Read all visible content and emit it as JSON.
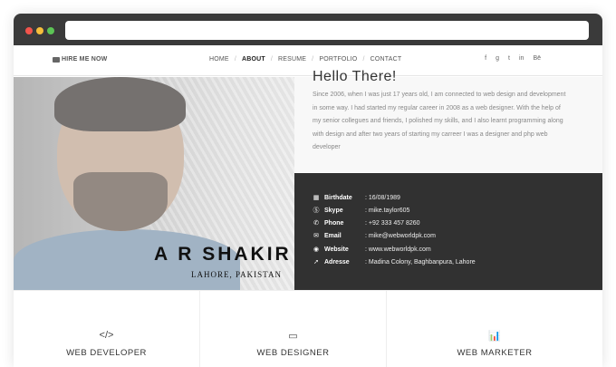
{
  "nav": {
    "hire_label": "HIRE ME NOW",
    "menu": [
      "HOME",
      "ABOUT",
      "RESUME",
      "PORTFOLIO",
      "CONTACT"
    ],
    "active": "ABOUT",
    "social": [
      "f",
      "g",
      "t",
      "in",
      "Bē"
    ]
  },
  "profile": {
    "name": "A R SHAKIR",
    "location": "LAHORE, PAKISTAN"
  },
  "about": {
    "heading": "Hello There!",
    "paragraph": "Since 2006, when I was just 17 years old, I am connected to web design and development in some way. I had started my regular career in 2008 as a web designer. With the help of my senior collegues and friends, I polished my skills, and I also learnt programming along with design and after two years of starting my carreer I was a designer and php web developer"
  },
  "info": [
    {
      "icon": "calendar-icon",
      "label": "Birthdate",
      "value": ": 16/08/1989"
    },
    {
      "icon": "skype-icon",
      "label": "Skype",
      "value": ": mike.taylor605"
    },
    {
      "icon": "phone-icon",
      "label": "Phone",
      "value": ": +92 333 457 8260"
    },
    {
      "icon": "envelope-icon",
      "label": "Email",
      "value": ": mike@webworldpk.com"
    },
    {
      "icon": "globe-icon",
      "label": "Website",
      "value": ": www.webworldpk.com"
    },
    {
      "icon": "location-arrow-icon",
      "label": "Adresse",
      "value": ": Madina Colony, Baghbanpura, Lahore"
    }
  ],
  "services": [
    {
      "icon": "code-icon",
      "glyph": "</>",
      "label": "WEB DEVELOPER"
    },
    {
      "icon": "laptop-icon",
      "glyph": "▭",
      "label": "WEB DESIGNER"
    },
    {
      "icon": "bar-chart-icon",
      "glyph": "📊",
      "label": "WEB MARKETER"
    }
  ]
}
